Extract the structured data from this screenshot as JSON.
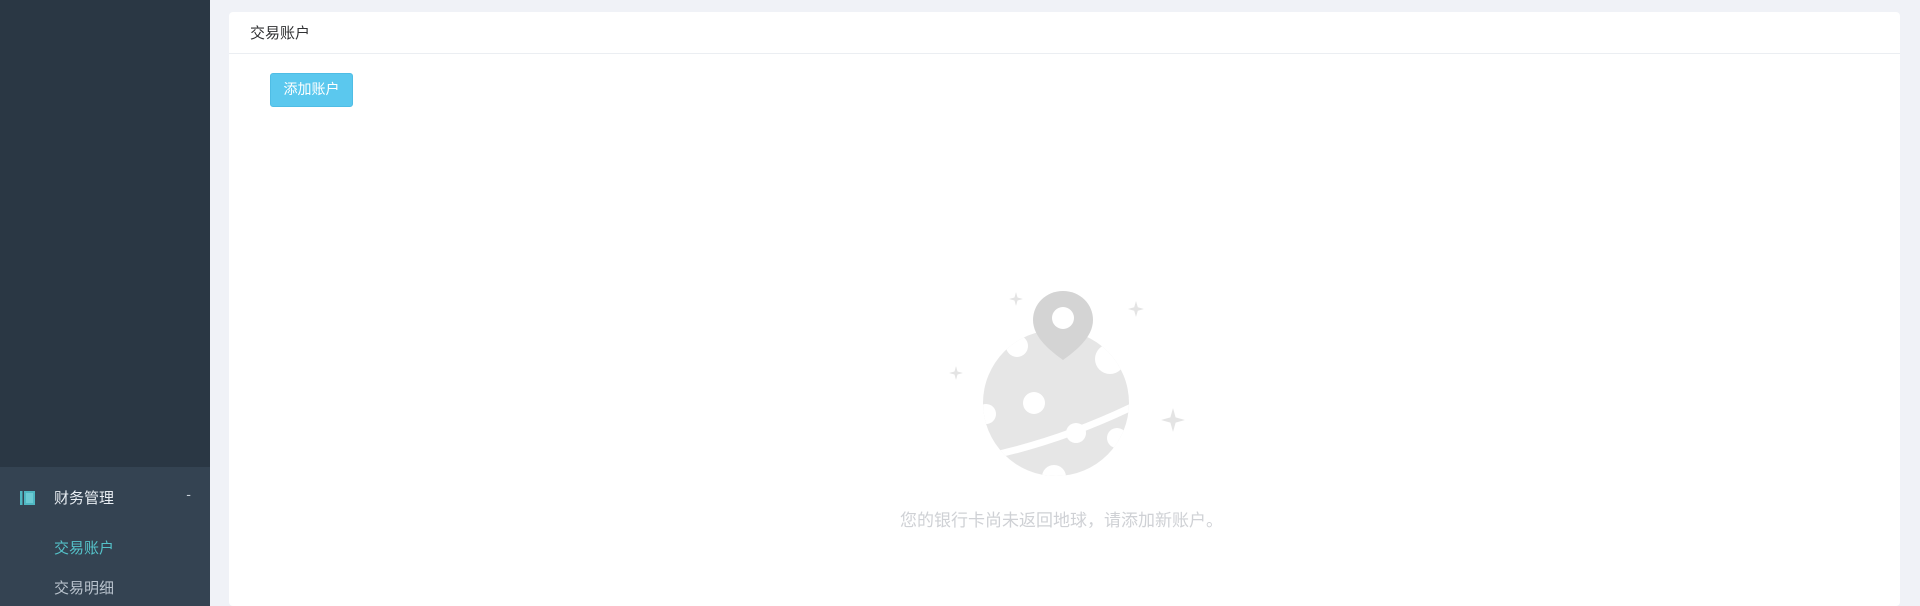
{
  "sidebar": {
    "group": {
      "icon": "book-icon",
      "label": "财务管理",
      "toggle": "-",
      "items": [
        {
          "label": "交易账户",
          "active": true
        },
        {
          "label": "交易明细",
          "active": false
        }
      ]
    }
  },
  "main": {
    "title": "交易账户",
    "add_button_label": "添加账户",
    "empty_state": {
      "icon": "planet-location-icon",
      "message": "您的银行卡尚未返回地球，请添加新账户。"
    }
  },
  "colors": {
    "sidebar_bg": "#2a3744",
    "menu_group_bg": "#344352",
    "accent_active": "#55c2c9",
    "button_bg": "#5bc8ee",
    "page_bg": "#f0f2f7"
  }
}
